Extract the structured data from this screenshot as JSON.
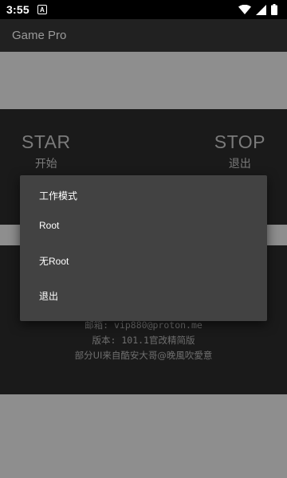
{
  "status_bar": {
    "time": "3:55",
    "notification_icon": "A",
    "icons": [
      "wifi-icon",
      "signal-icon",
      "battery-icon"
    ]
  },
  "app_bar": {
    "title": "Game Pro"
  },
  "controls": {
    "start_label": "STAR",
    "start_sub": "开始",
    "stop_label": "STOP",
    "stop_sub": "退出"
  },
  "info": {
    "email": "邮箱: vip880@proton.me",
    "version": "版本: 101.1官改精简版",
    "credit": "部分UI来自酷安大哥@晚風吹愛意"
  },
  "dialog": {
    "title": "工作模式",
    "options": [
      {
        "label": "Root"
      },
      {
        "label": "无Root"
      },
      {
        "label": "退出"
      }
    ]
  },
  "colors": {
    "background": "#111111",
    "app_bar": "#212121",
    "gray_band": "#8e8e8e",
    "panel": "#1a1a1a",
    "dialog": "#424242"
  }
}
